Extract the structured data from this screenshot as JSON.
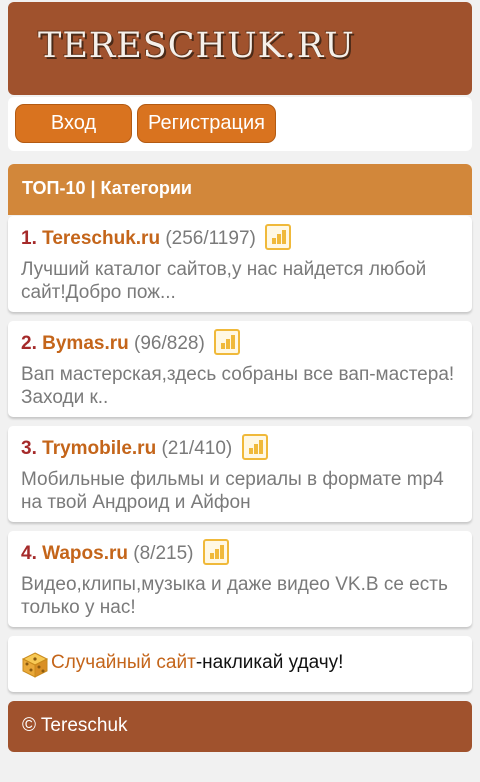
{
  "header": {
    "logo_text": "TERESCHUK.RU"
  },
  "auth": {
    "login_label": "Вход",
    "register_label": "Регистрация"
  },
  "section": {
    "title": "ТОП-10 | Категории"
  },
  "sites": [
    {
      "rank": "1.",
      "name": "Tereschuk.ru",
      "stats": "(256/1197)",
      "desc": "Лучший каталог сайтов,у нас найдется любой сайт!Добро пож..."
    },
    {
      "rank": "2.",
      "name": "Bymas.ru",
      "stats": "(96/828)",
      "desc": "Вап мастерская,здесь собраны все вап-мастера!Заходи к.."
    },
    {
      "rank": "3.",
      "name": "Trymobile.ru",
      "stats": "(21/410)",
      "desc": "Мобильные фильмы и сериалы в формате mp4 на твой Андроид и Айфон"
    },
    {
      "rank": "4.",
      "name": "Wapos.ru",
      "stats": "(8/215)",
      "desc": "Видео,клипы,музыка и даже видео VK.В се есть только у нас!"
    }
  ],
  "random": {
    "link_label": "Случайный сайт",
    "tail": "-накликай удачу!"
  },
  "footer": {
    "copyright": "© Tereschuk"
  },
  "colors": {
    "brand_brown": "#a0522d",
    "accent_orange": "#d9731f",
    "link_orange": "#c4651a",
    "rank_red": "#a52a2a",
    "stats_icon": "#f0b93a"
  }
}
